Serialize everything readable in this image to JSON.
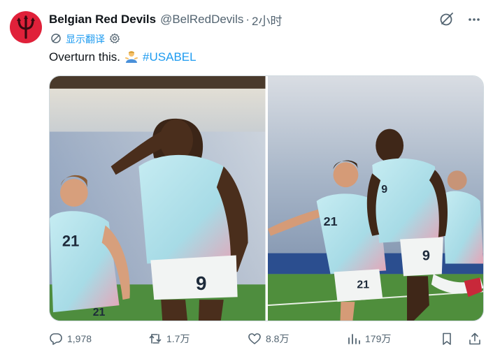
{
  "author": {
    "display_name": "Belgian Red Devils",
    "handle": "@BelRedDevils",
    "separator": "·",
    "time": "2小时",
    "avatar_color": "#e0213a"
  },
  "translate": {
    "label": "显示翻译"
  },
  "tweet": {
    "text": "Overturn this.",
    "emoji": "man-shrugging-emoji",
    "hashtag": "#USABEL"
  },
  "media": {
    "photos": [
      {
        "jersey_numbers": [
          "21",
          "9"
        ],
        "kit_color": "#b9e4ef"
      },
      {
        "jersey_numbers": [
          "21",
          "9"
        ],
        "kit_color": "#b9e4ef"
      }
    ]
  },
  "actions": {
    "replies": "1,978",
    "reposts": "1.7万",
    "likes": "8.8万",
    "views": "179万"
  },
  "colors": {
    "accent": "#1d9bf0",
    "muted": "#536471",
    "text": "#0f1419"
  }
}
